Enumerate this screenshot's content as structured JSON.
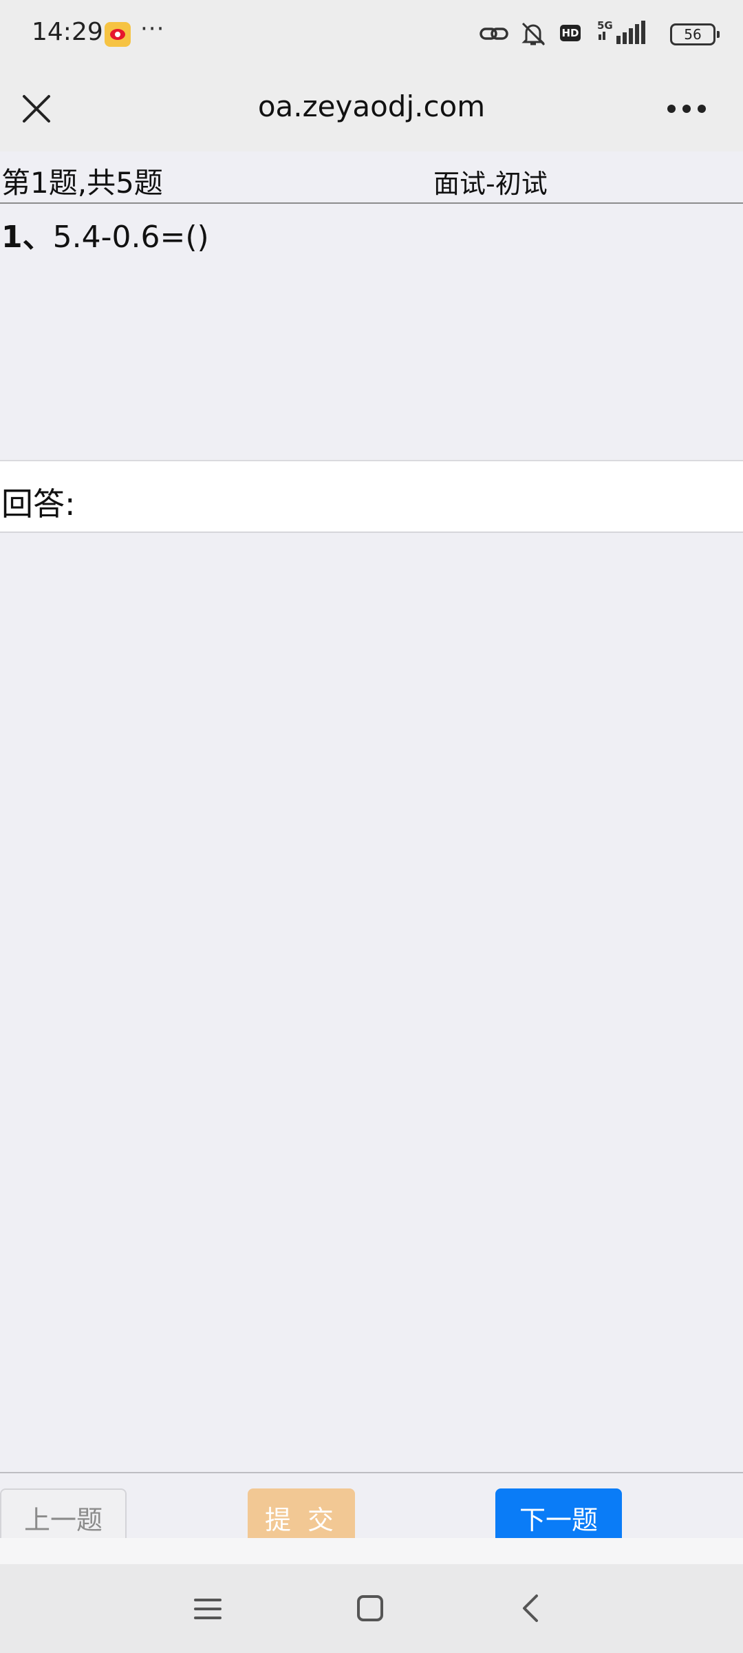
{
  "status_bar": {
    "time": "14:29",
    "more": "···",
    "battery": "56",
    "hd": "HD",
    "network": "5G",
    "icons": [
      "weibo-icon",
      "link-icon",
      "bell-off-icon",
      "hd-icon",
      "signal-5g-icon",
      "battery-icon"
    ]
  },
  "browser": {
    "title": "oa.zeyaodj.com",
    "icons": [
      "close-icon",
      "more-icon"
    ]
  },
  "quiz": {
    "progress": "第1题,共5题",
    "exam_name": "面试-初试",
    "question_number": "1、",
    "question_text": "5.4-0.6=()",
    "answer_label": "回答:"
  },
  "footer": {
    "prev_label": "上一题",
    "submit_label": "提 交",
    "next_label": "下一题"
  },
  "colors": {
    "next_button": "#0a7cf7",
    "submit_button": "#f2c894",
    "page_background": "#efeff4"
  },
  "system_nav": {
    "icons": [
      "menu-icon",
      "home-icon",
      "back-icon"
    ]
  }
}
